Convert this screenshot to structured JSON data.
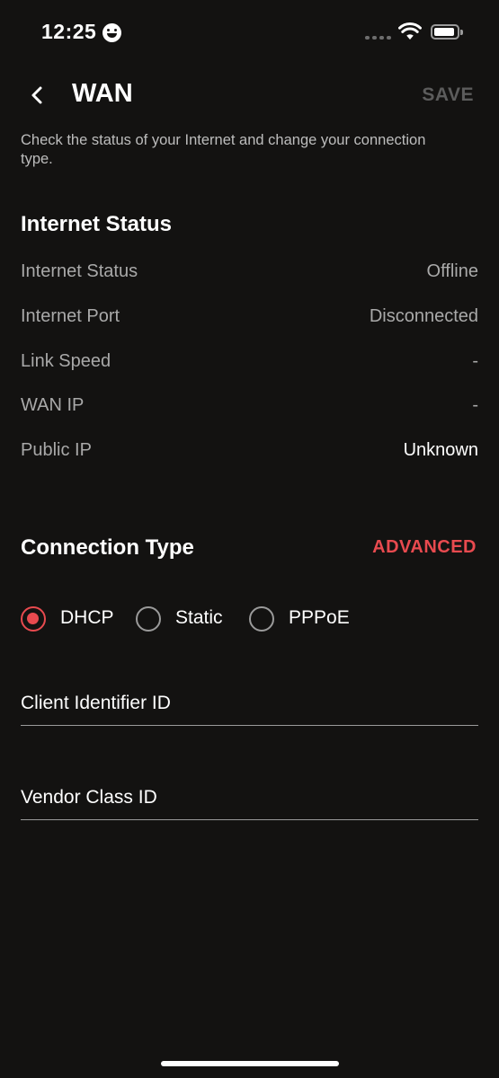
{
  "status_bar": {
    "time": "12:25"
  },
  "header": {
    "title": "WAN",
    "save_label": "SAVE"
  },
  "subtitle": "Check the status of your Internet and change your connection type.",
  "internet_status": {
    "section_title": "Internet Status",
    "rows": [
      {
        "label": "Internet Status",
        "value": "Offline"
      },
      {
        "label": "Internet Port",
        "value": "Disconnected"
      },
      {
        "label": "Link Speed",
        "value": "-"
      },
      {
        "label": "WAN IP",
        "value": "-"
      },
      {
        "label": "Public IP",
        "value": "Unknown"
      }
    ]
  },
  "connection_type": {
    "section_title": "Connection Type",
    "advanced_label": "ADVANCED",
    "options": [
      {
        "label": "DHCP",
        "selected": true
      },
      {
        "label": "Static",
        "selected": false
      },
      {
        "label": "PPPoE",
        "selected": false
      }
    ]
  },
  "fields": {
    "client_identifier": {
      "placeholder": "Client Identifier ID",
      "value": ""
    },
    "vendor_class": {
      "placeholder": "Vendor Class ID",
      "value": ""
    }
  },
  "colors": {
    "accent": "#e84a4f",
    "background": "#131211",
    "muted_text": "#a9a9a9",
    "disabled": "#5c5c5c"
  }
}
